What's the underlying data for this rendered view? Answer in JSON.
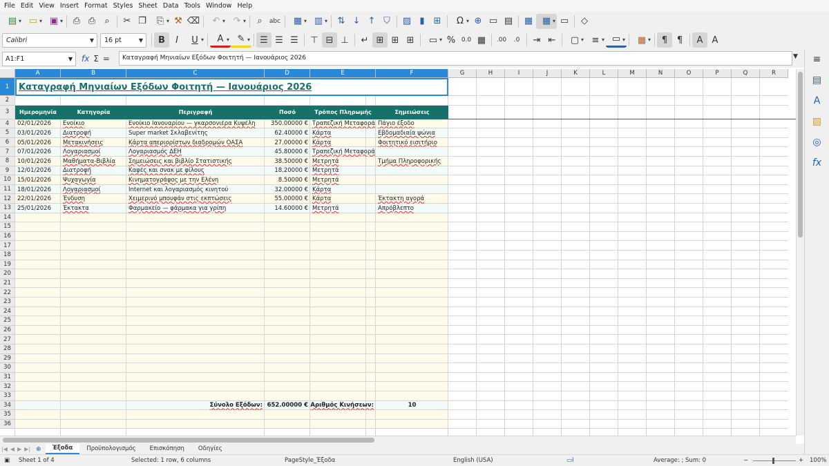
{
  "menu": [
    "File",
    "Edit",
    "View",
    "Insert",
    "Format",
    "Styles",
    "Sheet",
    "Data",
    "Tools",
    "Window",
    "Help"
  ],
  "toolbar": {
    "font_name": "Calibri",
    "font_size": "16 pt",
    "bold_label": "B",
    "italic_label": "I",
    "underline_label": "U",
    "font_color_label": "A",
    "percent_label": "%",
    "decimal_label": "0.0",
    "add_decimal_label": ".00",
    "del_decimal_label": ".0",
    "accent_color": "#2a5fa8",
    "font_color": "#d11f1f",
    "highlight_color": "#f2d51c"
  },
  "formula": {
    "name_box": "A1:F1",
    "content": "Καταγραφή Μηνιαίων Εξόδων Φοιτητή — Ιανουάριος 2026"
  },
  "columns": [
    "A",
    "B",
    "C",
    "D",
    "E",
    "F",
    "G",
    "H",
    "I",
    "J",
    "K",
    "L",
    "M",
    "N",
    "O",
    "P",
    "Q",
    "R"
  ],
  "title": "Καταγραφή Μηνιαίων Εξόδων Φοιτητή — Ιανουάριος 2026",
  "headers": [
    "Ημερομηνία",
    "Κατηγορία",
    "Περιγραφή",
    "Ποσό",
    "Τρόπος Πληρωμής",
    "Σημειώσεις"
  ],
  "rows": [
    [
      "02/01/2026",
      "Ενοίκιο",
      "Ενοίκιο Ιανουαρίου — γκαρσονιέρα Κυψέλη",
      "350.00000 €",
      "Τραπεζική Μεταφορά",
      "Πάγιο έξοδο"
    ],
    [
      "03/01/2026",
      "Διατροφή",
      "Super market Σκλαβενίτης",
      "62.40000 €",
      "Κάρτα",
      "Εβδομαδιαία ψώνια"
    ],
    [
      "05/01/2026",
      "Μετακινήσεις",
      "Κάρτα απεριορίστων διαδρομών ΟΑΣΑ",
      "27.00000 €",
      "Κάρτα",
      "Φοιτητικό εισιτήριο"
    ],
    [
      "07/01/2026",
      "Λογαριασμοί",
      "Λογαριασμός ΔΕΗ",
      "45.80000 €",
      "Τραπεζική Μεταφορά",
      ""
    ],
    [
      "10/01/2026",
      "Μαθήματα-Βιβλία",
      "Σημειώσεις και βιβλίο Στατιστικής",
      "38.50000 €",
      "Μετρητά",
      "Τμήμα Πληροφορικής"
    ],
    [
      "12/01/2026",
      "Διατροφή",
      "Καφές και σνακ με φίλους",
      "18.20000 €",
      "Μετρητά",
      ""
    ],
    [
      "15/01/2026",
      "Ψυχαγωγία",
      "Κινηματογράφος με την Ελένη",
      "8.50000 €",
      "Μετρητά",
      ""
    ],
    [
      "18/01/2026",
      "Λογαριασμοί",
      "Internet και λογαριασμός κινητού",
      "32.00000 €",
      "Κάρτα",
      ""
    ],
    [
      "22/01/2026",
      "Ένδυση",
      "Χειμερινό μπουφάν στις εκπτώσεις",
      "55.00000 €",
      "Κάρτα",
      "Έκτακτη αγορά"
    ],
    [
      "25/01/2026",
      "Έκτακτα",
      "Φαρμακείο — φάρμακα για γρίπη",
      "14.60000 €",
      "Μετρητά",
      "Απρόβλεπτο"
    ]
  ],
  "summary": {
    "total_label": "Σύνολο Εξόδων:",
    "total_value": "652.00000 €",
    "count_label": "Αριθμός Κινήσεων:",
    "count_value": "10"
  },
  "row_numbers": [
    "1",
    "2",
    "3",
    "4",
    "5",
    "6",
    "7",
    "8",
    "9",
    "10",
    "11",
    "12",
    "13",
    "14",
    "15",
    "16",
    "17",
    "18",
    "19",
    "20",
    "21",
    "22",
    "23",
    "24",
    "25",
    "26",
    "27",
    "28",
    "29",
    "30",
    "31",
    "32",
    "33",
    "34",
    "35",
    "36"
  ],
  "sheet_tabs": [
    "Έξοδα",
    "Προϋπολογισμός",
    "Επισκόπηση",
    "Οδηγίες"
  ],
  "active_tab": "Έξοδα",
  "status": {
    "sheet": "Sheet 1 of 4",
    "selection": "Selected: 1 row, 6 columns",
    "page_style": "PageStyle_Έξοδα",
    "language": "English (USA)",
    "sum": "Average: ; Sum: 0",
    "zoom": "100%"
  },
  "colors": {
    "header_bg": "#18706a",
    "title_color": "#18706a",
    "fill_even": "#f3fbf8",
    "fill_odd": "#fefbea",
    "selection": "#2a88d8"
  }
}
